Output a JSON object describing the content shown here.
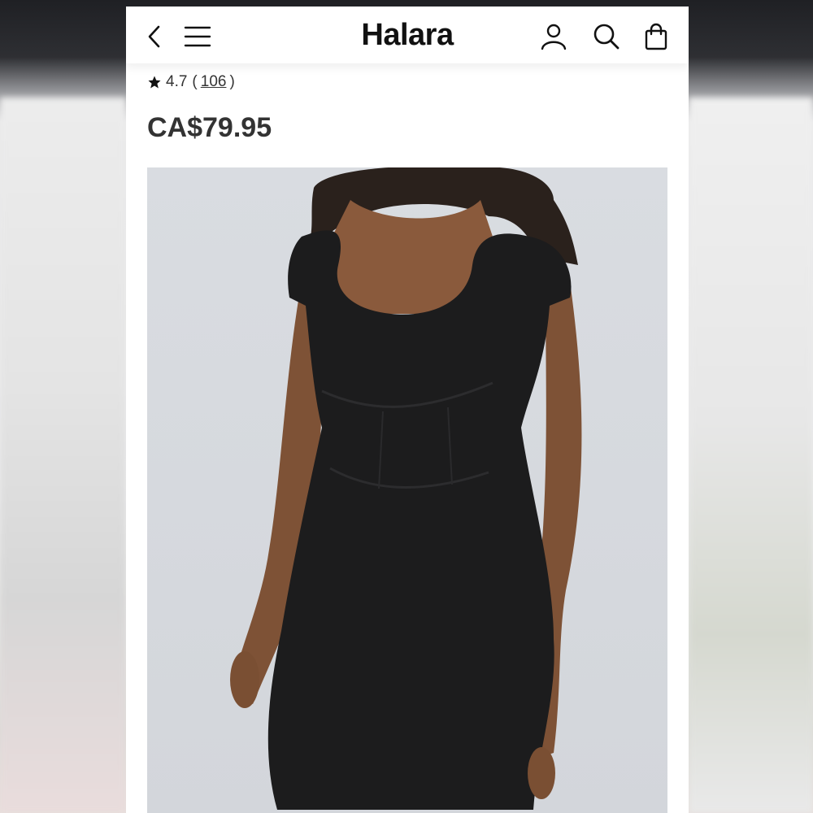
{
  "header": {
    "brand": "Halara",
    "back_icon": "chevron-left-icon",
    "menu_icon": "hamburger-menu-icon",
    "account_icon": "user-icon",
    "search_icon": "search-icon",
    "bag_icon": "shopping-bag-icon"
  },
  "product": {
    "rating": "4.7",
    "rating_open": "(",
    "review_count": "106",
    "rating_close": ")",
    "price": "CA$79.95",
    "image_description_icon": "product-photo"
  },
  "colors": {
    "background_top": "#1f2024",
    "page": "#ffffff",
    "text_primary": "#111111",
    "text_secondary": "#333333",
    "image_backdrop": "#d9dce1"
  }
}
